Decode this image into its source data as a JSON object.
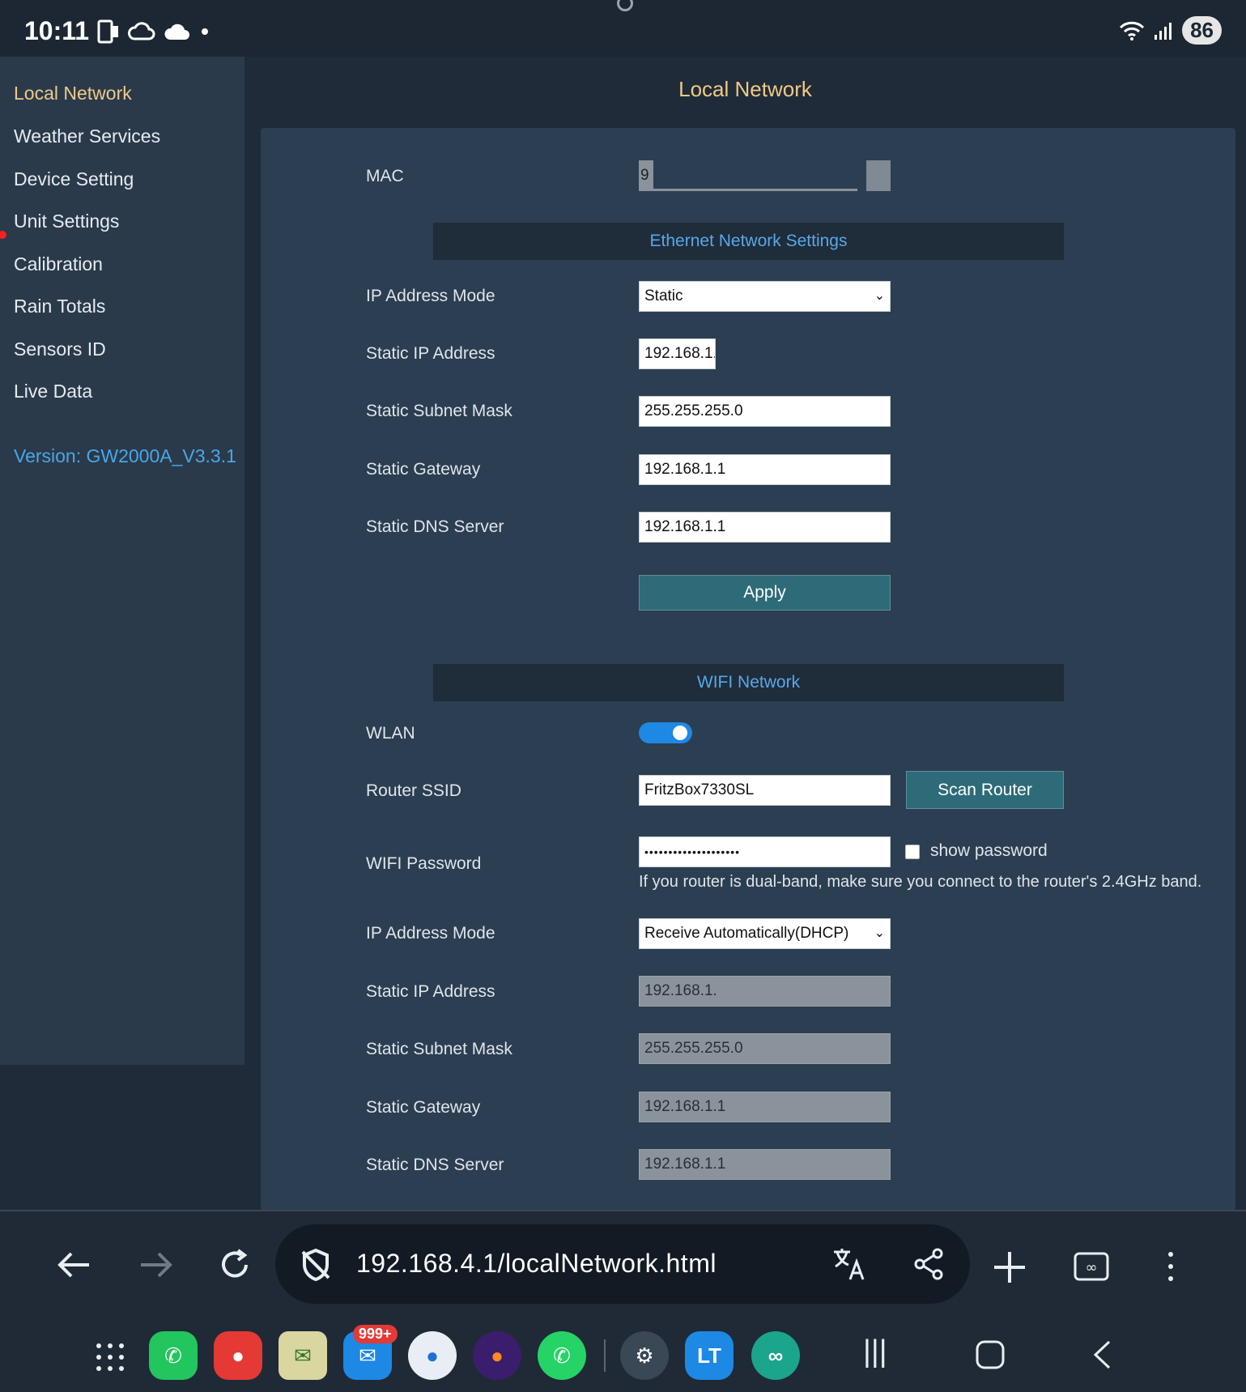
{
  "status_bar": {
    "time": "10:11",
    "battery": "86"
  },
  "sidebar": {
    "items": [
      {
        "label": "Local Network",
        "active": true
      },
      {
        "label": "Weather Services"
      },
      {
        "label": "Device Setting"
      },
      {
        "label": "Unit Settings"
      },
      {
        "label": "Calibration"
      },
      {
        "label": "Rain Totals"
      },
      {
        "label": "Sensors ID"
      },
      {
        "label": "Live Data"
      }
    ],
    "version": "Version: GW2000A_V3.3.1"
  },
  "main": {
    "title": "Local Network",
    "mac": {
      "label": "MAC",
      "value": "9"
    },
    "ethernet": {
      "title": "Ethernet Network Settings",
      "ip_mode_label": "IP Address Mode",
      "ip_mode_value": "Static",
      "static_ip_label": "Static IP Address",
      "static_ip_value": "192.168.1.",
      "subnet_label": "Static Subnet Mask",
      "subnet_value": "255.255.255.0",
      "gateway_label": "Static Gateway",
      "gateway_value": "192.168.1.1",
      "dns_label": "Static DNS Server",
      "dns_value": "192.168.1.1",
      "apply_label": "Apply"
    },
    "wifi": {
      "title": "WIFI Network",
      "wlan_label": "WLAN",
      "wlan_enabled": true,
      "ssid_label": "Router SSID",
      "ssid_value": "FritzBox7330SL",
      "scan_label": "Scan Router",
      "password_label": "WIFI Password",
      "password_value": "••••••••••••••••••••",
      "show_password_label": "show password",
      "hint": "If you router is dual-band, make sure you connect to the router's 2.4GHz band.",
      "ip_mode_label": "IP Address Mode",
      "ip_mode_value": "Receive Automatically(DHCP)",
      "static_ip_label": "Static IP Address",
      "static_ip_value": "192.168.1.",
      "subnet_label": "Static Subnet Mask",
      "subnet_value": "255.255.255.0",
      "gateway_label": "Static Gateway",
      "gateway_value": "192.168.1.1",
      "dns_label": "Static DNS Server",
      "dns_value": "192.168.1.1"
    }
  },
  "browser": {
    "url": "192.168.4.1/localNetwork.html"
  },
  "dock": {
    "mail_badge": "999+",
    "lt_label": "LT"
  },
  "colors": {
    "accent": "#f0c987",
    "link": "#4aa6e6",
    "section_text": "#58a8e8",
    "button": "#2e6b79"
  }
}
